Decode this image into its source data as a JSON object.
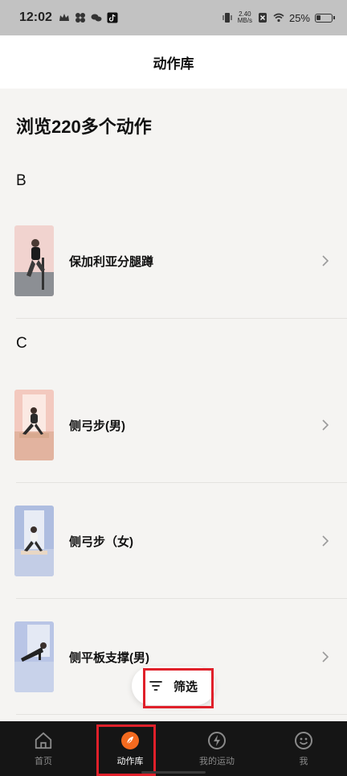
{
  "status_bar": {
    "time": "12:02",
    "net_speed_top": "2.40",
    "net_speed_bottom": "MB/s",
    "battery": "25%"
  },
  "header": {
    "title": "动作库"
  },
  "page": {
    "title": "浏览220多个动作"
  },
  "sections": [
    {
      "letter": "B",
      "items": [
        {
          "name": "保加利亚分腿蹲",
          "thumb_bg": "#f1d3cf"
        }
      ]
    },
    {
      "letter": "C",
      "items": [
        {
          "name": "侧弓步(男)",
          "thumb_bg": "#f3c9bf"
        },
        {
          "name": "侧弓步（女)",
          "thumb_bg": "#aebde0"
        },
        {
          "name": "侧平板支撑(男)",
          "thumb_bg": "#b9c5e6"
        }
      ]
    }
  ],
  "filter": {
    "label": "筛选"
  },
  "tabs": [
    {
      "label": "首页",
      "icon": "home-icon"
    },
    {
      "label": "动作库",
      "icon": "leaf-icon"
    },
    {
      "label": "我的运动",
      "icon": "lightning-icon"
    },
    {
      "label": "我",
      "icon": "smiley-icon"
    }
  ],
  "colors": {
    "accent": "#f36a1f",
    "highlight": "#e0202a",
    "tabbar": "#151515"
  }
}
